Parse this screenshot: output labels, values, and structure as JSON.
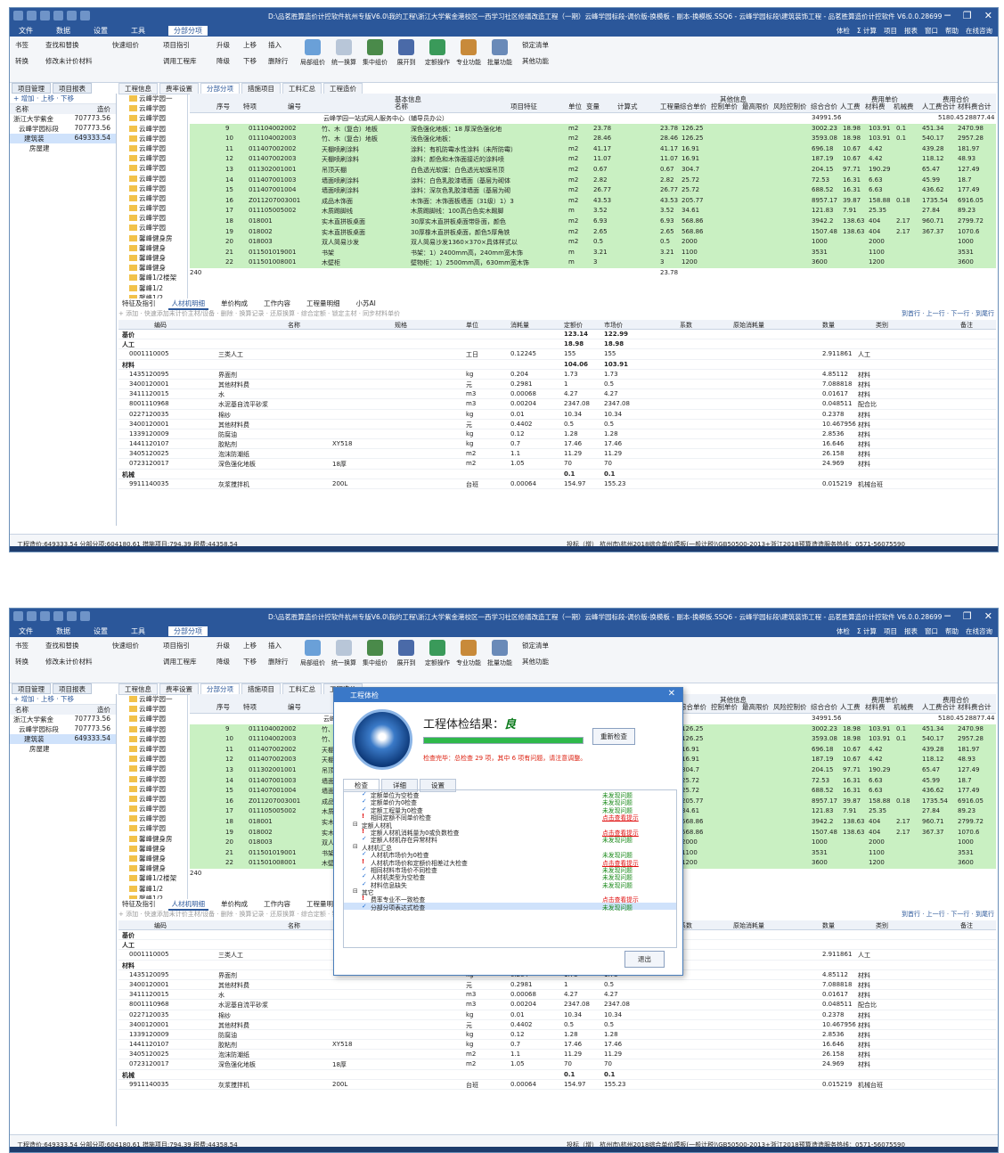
{
  "window": {
    "title": "D:\\品茗胜算造价计控软件杭州专版V6.0\\我的工程\\浙江大学紫金港校区一西学习社区修缮改造工程（一期）云峰学园标段-调价版-换模板 - 副本-换模板.SSQ6 - 云峰学园标段\\建筑装饰工程 - 品茗胜算造价计控软件  V6.0.0.28699",
    "controls": [
      "─",
      "❐",
      "✕"
    ]
  },
  "menu": {
    "items": [
      "文件",
      "数据",
      "设置",
      "工具",
      "分部分项"
    ],
    "right": [
      "体检",
      "Σ 计算",
      "项目",
      "报表",
      "窗口",
      "帮助",
      "在线咨询"
    ]
  },
  "ribbon": {
    "items": [
      "书签",
      "查找和替换",
      "快速组价",
      "项目指引",
      "升级",
      "上移",
      "插入",
      "局部组价",
      "统一换算",
      "集中组价",
      "展开到",
      "定额操作",
      "专业功能",
      "批量功能",
      "锁定清单",
      "其他功能",
      "转换",
      "修改未计价材料",
      "调用工程库",
      "降级",
      "下移",
      "删除行"
    ]
  },
  "nav": {
    "tabs": [
      "项目管理",
      "项目报表"
    ],
    "toolbar": "+ 增加 · 上移 · 下移",
    "headers": [
      "名称",
      "造价"
    ],
    "tree": [
      {
        "name": "浙江大学紫金",
        "cost": "707773.56"
      },
      {
        "name": "云峰学园标段",
        "cost": "707773.56"
      },
      {
        "name": "建筑装",
        "cost": "649333.54"
      },
      {
        "name": "房屋建",
        "cost": ""
      }
    ]
  },
  "tabs": [
    "工程信息",
    "费率设置",
    "分部分项",
    "措施项目",
    "工料汇总",
    "工程造价"
  ],
  "subtree": [
    "云峰学园一",
    "云峰学园",
    "云峰学园",
    "云峰学园",
    "云峰学园",
    "云峰学园",
    "云峰学园",
    "云峰学园",
    "云峰学园",
    "云峰学园",
    "云峰学园",
    "云峰学园",
    "云峰学园",
    "云峰学园",
    "馨峰健身房",
    "馨峰健身",
    "馨峰健身",
    "馨峰健身",
    "馨峰1/2楼架",
    "馨峰1/2",
    "馨峰1/2"
  ],
  "grid": {
    "headers": [
      "序号",
      "特项",
      "编号",
      "基本信息",
      "名称",
      "项目特征",
      "单位",
      "变量",
      "计算式",
      "工程量",
      "其他信息",
      "综合单价",
      "控制单价",
      "最高限价",
      "风险控制价",
      "综合合价",
      "人工费",
      "费用单价",
      "材料费",
      "机械费",
      "费用合价",
      "人工费合计",
      "材料费合计"
    ],
    "group": {
      "name": "云峰学园一站式网人服务中心（辅导员办公）",
      "total": "34991.56",
      "labor": "5180.45",
      "mat": "28877.44"
    },
    "rows": [
      {
        "no": "9",
        "code": "011104002002",
        "name": "竹、木（复合）地板",
        "feature": "深色强化地板：18 厚深色强化地",
        "unit": "m2",
        "calc": "23.78",
        "qty": "23.78",
        "price": "126.25",
        "total": "3002.23",
        "lab": "18.98",
        "mat": "103.91",
        "mach": "0.1",
        "labt": "451.34",
        "matt": "2470.98"
      },
      {
        "no": "10",
        "code": "011104002003",
        "name": "竹、木（复合）地板",
        "feature": "浅色强化地板：",
        "unit": "m2",
        "calc": "28.46",
        "qty": "28.46",
        "price": "126.25",
        "total": "3593.08",
        "lab": "18.98",
        "mat": "103.91",
        "mach": "0.1",
        "labt": "540.17",
        "matt": "2957.28"
      },
      {
        "no": "11",
        "code": "011407002002",
        "name": "天棚喷刷涂料",
        "feature": "涂料：有机防霉水性涂料（未所防霉）",
        "unit": "m2",
        "calc": "41.17",
        "qty": "41.17",
        "price": "16.91",
        "total": "696.18",
        "lab": "10.67",
        "mat": "4.42",
        "mach": "",
        "labt": "439.28",
        "matt": "181.97"
      },
      {
        "no": "12",
        "code": "011407002003",
        "name": "天棚喷刷涂料",
        "feature": "涂料：颜色和木饰面接近的涂料喷",
        "unit": "m2",
        "calc": "11.07",
        "qty": "11.07",
        "price": "16.91",
        "total": "187.19",
        "lab": "10.67",
        "mat": "4.42",
        "mach": "",
        "labt": "118.12",
        "matt": "48.93"
      },
      {
        "no": "13",
        "code": "011302001001",
        "name": "吊顶天棚",
        "feature": "白色透光软膜：白色透光软膜吊顶",
        "unit": "m2",
        "calc": "0.67",
        "qty": "0.67",
        "price": "304.7",
        "total": "204.15",
        "lab": "97.71",
        "mat": "190.29",
        "mach": "",
        "labt": "65.47",
        "matt": "127.49"
      },
      {
        "no": "14",
        "code": "011407001003",
        "name": "墙面喷刷涂料",
        "feature": "涂料：白色乳胶漆墙面（基层为砌体",
        "unit": "m2",
        "calc": "2.82",
        "qty": "2.82",
        "price": "25.72",
        "total": "72.53",
        "lab": "16.31",
        "mat": "6.63",
        "mach": "",
        "labt": "45.99",
        "matt": "18.7"
      },
      {
        "no": "15",
        "code": "011407001004",
        "name": "墙面喷刷涂料",
        "feature": "涂料：深灰色乳胶漆墙面（基层为砌",
        "unit": "m2",
        "calc": "26.77",
        "qty": "26.77",
        "price": "25.72",
        "total": "688.52",
        "lab": "16.31",
        "mat": "6.63",
        "mach": "",
        "labt": "436.62",
        "matt": "177.49"
      },
      {
        "no": "16",
        "code": "Z011207003001",
        "name": "成品木饰面",
        "feature": "木饰面：木饰面板墙面（31级）1）3",
        "unit": "m2",
        "calc": "43.53",
        "qty": "43.53",
        "price": "205.77",
        "total": "8957.17",
        "lab": "39.87",
        "mat": "158.88",
        "mach": "0.18",
        "labt": "1735.54",
        "matt": "6916.05"
      },
      {
        "no": "17",
        "code": "011105005002",
        "name": "木质踢脚线",
        "feature": "木质踢脚线：100高白色实木踢脚",
        "unit": "m",
        "calc": "3.52",
        "qty": "3.52",
        "price": "34.61",
        "total": "121.83",
        "lab": "7.91",
        "mat": "25.35",
        "mach": "",
        "labt": "27.84",
        "matt": "89.23"
      },
      {
        "no": "18",
        "code": "018001",
        "name": "实木直拼板桌面",
        "feature": "30厚实木直拼板桌面带卧面，颜色",
        "unit": "m2",
        "calc": "6.93",
        "qty": "6.93",
        "price": "568.86",
        "total": "3942.2",
        "lab": "138.63",
        "mat": "404",
        "mach": "2.17",
        "labt": "960.71",
        "matt": "2799.72"
      },
      {
        "no": "19",
        "code": "018002",
        "name": "实木直拼板桌面",
        "feature": "30厚橡木直拼板桌面，颜色5厚角铁",
        "unit": "m2",
        "calc": "2.65",
        "qty": "2.65",
        "price": "568.86",
        "total": "1507.48",
        "lab": "138.63",
        "mat": "404",
        "mach": "2.17",
        "labt": "367.37",
        "matt": "1070.6"
      },
      {
        "no": "20",
        "code": "018003",
        "name": "双人简易沙发",
        "feature": "双人简易沙发1360×370×具体样式以",
        "unit": "m2",
        "calc": "0.5",
        "qty": "0.5",
        "price": "2000",
        "total": "1000",
        "lab": "",
        "mat": "2000",
        "mach": "",
        "labt": "",
        "matt": "1000"
      },
      {
        "no": "21",
        "code": "011501019001",
        "name": "书架",
        "feature": "书架：1）2400mm高，240mm宽木饰",
        "unit": "m",
        "calc": "3.21",
        "qty": "3.21",
        "price": "1100",
        "total": "3531",
        "lab": "",
        "mat": "1100",
        "mach": "",
        "labt": "",
        "matt": "3531"
      },
      {
        "no": "22",
        "code": "011501008001",
        "name": "木壁柜",
        "feature": "壁物柜：1）2500mm高，630mm宽木饰",
        "unit": "m",
        "calc": "3",
        "qty": "3",
        "price": "1200",
        "total": "3600",
        "lab": "",
        "mat": "1200",
        "mach": "",
        "labt": "",
        "matt": "3600"
      }
    ],
    "footer_qty": "23.78",
    "footer_240": "240"
  },
  "lower_tabs": [
    "特征及指引",
    "人材机明细",
    "单价构成",
    "工作内容",
    "工程量明细",
    "小苏AI"
  ],
  "lower_toolbar": {
    "left": "+ 添加 · 快速添加未计价主材/设备 · 删除 · 换算记录 · 还原换算 · 综合定额 · 锁定主材 · 同步材料单价",
    "right": "到首行 · 上一行 · 下一行 · 到尾行"
  },
  "lower_headers": [
    "编码",
    "名称",
    "规格",
    "单位",
    "消耗量",
    "定额价",
    "市场价",
    "系数",
    "原始消耗量",
    "数量",
    "类别",
    "备注"
  ],
  "lower_rows": [
    {
      "code": "基价",
      "name": "",
      "spec": "",
      "unit": "",
      "cons": "",
      "dj": "123.14",
      "sj": "122.99",
      "qty": "",
      "cat": "",
      "bold": true
    },
    {
      "code": "人工",
      "name": "",
      "spec": "",
      "unit": "",
      "cons": "",
      "dj": "18.98",
      "sj": "18.98",
      "qty": "",
      "cat": "",
      "bold": true
    },
    {
      "code": "0001110005",
      "name": "三类人工",
      "spec": "",
      "unit": "工日",
      "cons": "0.12245",
      "dj": "155",
      "sj": "155",
      "qty": "2.911861",
      "cat": "人工",
      "bold": false
    },
    {
      "code": "材料",
      "name": "",
      "spec": "",
      "unit": "",
      "cons": "",
      "dj": "104.06",
      "sj": "103.91",
      "qty": "",
      "cat": "",
      "bold": true
    },
    {
      "code": "1435120095",
      "name": "界面剂",
      "spec": "",
      "unit": "kg",
      "cons": "0.204",
      "dj": "1.73",
      "sj": "1.73",
      "qty": "4.85112",
      "cat": "材料",
      "bold": false
    },
    {
      "code": "3400120001",
      "name": "其他材料费",
      "spec": "",
      "unit": "元",
      "cons": "0.2981",
      "dj": "1",
      "sj": "0.5",
      "qty": "7.088818",
      "cat": "材料",
      "bold": false
    },
    {
      "code": "3411120015",
      "name": "水",
      "spec": "",
      "unit": "m3",
      "cons": "0.00068",
      "dj": "4.27",
      "sj": "4.27",
      "qty": "0.01617",
      "cat": "材料",
      "bold": false
    },
    {
      "code": "8001110968",
      "name": "水泥基自流平砂浆",
      "spec": "",
      "unit": "m3",
      "cons": "0.00204",
      "dj": "2347.08",
      "sj": "2347.08",
      "qty": "0.048511",
      "cat": "配合比",
      "bold": false
    },
    {
      "code": "0227120035",
      "name": "棉纱",
      "spec": "",
      "unit": "kg",
      "cons": "0.01",
      "dj": "10.34",
      "sj": "10.34",
      "qty": "0.2378",
      "cat": "材料",
      "bold": false
    },
    {
      "code": "3400120001",
      "name": "其他材料费",
      "spec": "",
      "unit": "元",
      "cons": "0.4402",
      "dj": "0.5",
      "sj": "0.5",
      "qty": "10.467956",
      "cat": "材料",
      "bold": false
    },
    {
      "code": "1339120009",
      "name": "防腐油",
      "spec": "",
      "unit": "kg",
      "cons": "0.12",
      "dj": "1.28",
      "sj": "1.28",
      "qty": "2.8536",
      "cat": "材料",
      "bold": false
    },
    {
      "code": "1441120107",
      "name": "胶粘剂",
      "spec": "XY518",
      "unit": "kg",
      "cons": "0.7",
      "dj": "17.46",
      "sj": "17.46",
      "qty": "16.646",
      "cat": "材料",
      "bold": false
    },
    {
      "code": "3405120025",
      "name": "泡沫防潮纸",
      "spec": "",
      "unit": "m2",
      "cons": "1.1",
      "dj": "11.29",
      "sj": "11.29",
      "qty": "26.158",
      "cat": "材料",
      "bold": false
    },
    {
      "code": "0723120017",
      "name": "深色强化地板",
      "spec": "18厚",
      "unit": "m2",
      "cons": "1.05",
      "dj": "70",
      "sj": "70",
      "qty": "24.969",
      "cat": "材料",
      "bold": false
    },
    {
      "code": "机械",
      "name": "",
      "spec": "",
      "unit": "",
      "cons": "",
      "dj": "0.1",
      "sj": "0.1",
      "qty": "",
      "cat": "",
      "bold": true
    },
    {
      "code": "9911140035",
      "name": "灰浆搅拌机",
      "spec": "200L",
      "unit": "台班",
      "cons": "0.00064",
      "dj": "154.97",
      "sj": "155.23",
      "qty": "0.015219",
      "cat": "机械台班",
      "bold": false
    }
  ],
  "status": {
    "left": "工程造价:649333.54 分部分项:604180.61 措施项目:794.39 税费:44358.54",
    "mid": "投标（增）   杭州市\\杭州2018综合单价模板(一般计税)\\GB50500-2013+浙江2018预算",
    "right": "造造服务热线：0571-56075590"
  },
  "dialog": {
    "title": "工程体检",
    "result_label": "工程体检结果：",
    "result_value": "良",
    "progress": 1.0,
    "summary": "检查完毕：总检查 29 项，其中 6 项有问题，请注意调整。",
    "recheck": "重新检查",
    "tabs": [
      "检查",
      "详细",
      "设置"
    ],
    "exit": "退出",
    "items": [
      {
        "indent": 2,
        "mark": "✓",
        "text": "定额单位为空检查",
        "status": "未发现问题",
        "ok": true
      },
      {
        "indent": 2,
        "mark": "✓",
        "text": "定额单价为0检查",
        "status": "未发现问题",
        "ok": true
      },
      {
        "indent": 2,
        "mark": "✓",
        "text": "定额工程量为0检查",
        "status": "未发现问题",
        "ok": true
      },
      {
        "indent": 2,
        "mark": "!",
        "text": "相同定额不同单价检查",
        "status": "点击查看提示",
        "ok": false
      },
      {
        "indent": 1,
        "mark": "⊟",
        "text": "定额人材机",
        "status": "",
        "ok": true
      },
      {
        "indent": 2,
        "mark": "!",
        "text": "定额人材机消耗量为0或负数检查",
        "status": "点击查看提示",
        "ok": false
      },
      {
        "indent": 2,
        "mark": "✓",
        "text": "定额人材机存在异常材料",
        "status": "未发现问题",
        "ok": true
      },
      {
        "indent": 1,
        "mark": "⊟",
        "text": "人材机汇总",
        "status": "",
        "ok": true
      },
      {
        "indent": 2,
        "mark": "✓",
        "text": "人材机市场价为0检查",
        "status": "未发现问题",
        "ok": true
      },
      {
        "indent": 2,
        "mark": "!",
        "text": "人材机市场价和定额价相差过大检查",
        "status": "点击查看提示",
        "ok": false
      },
      {
        "indent": 2,
        "mark": "✓",
        "text": "相同材料市场价不同检查",
        "status": "未发现问题",
        "ok": true
      },
      {
        "indent": 2,
        "mark": "✓",
        "text": "人材机类型为空检查",
        "status": "未发现问题",
        "ok": true
      },
      {
        "indent": 2,
        "mark": "✓",
        "text": "材料信息缺失",
        "status": "未发现问题",
        "ok": true
      },
      {
        "indent": 1,
        "mark": "⊟",
        "text": "其它",
        "status": "",
        "ok": true
      },
      {
        "indent": 2,
        "mark": "!",
        "text": "费率专业不一致检查",
        "status": "点击查看提示",
        "ok": false
      },
      {
        "indent": 2,
        "mark": "✓",
        "text": "分部分项表达式检查",
        "status": "未发现问题",
        "ok": true
      }
    ]
  }
}
